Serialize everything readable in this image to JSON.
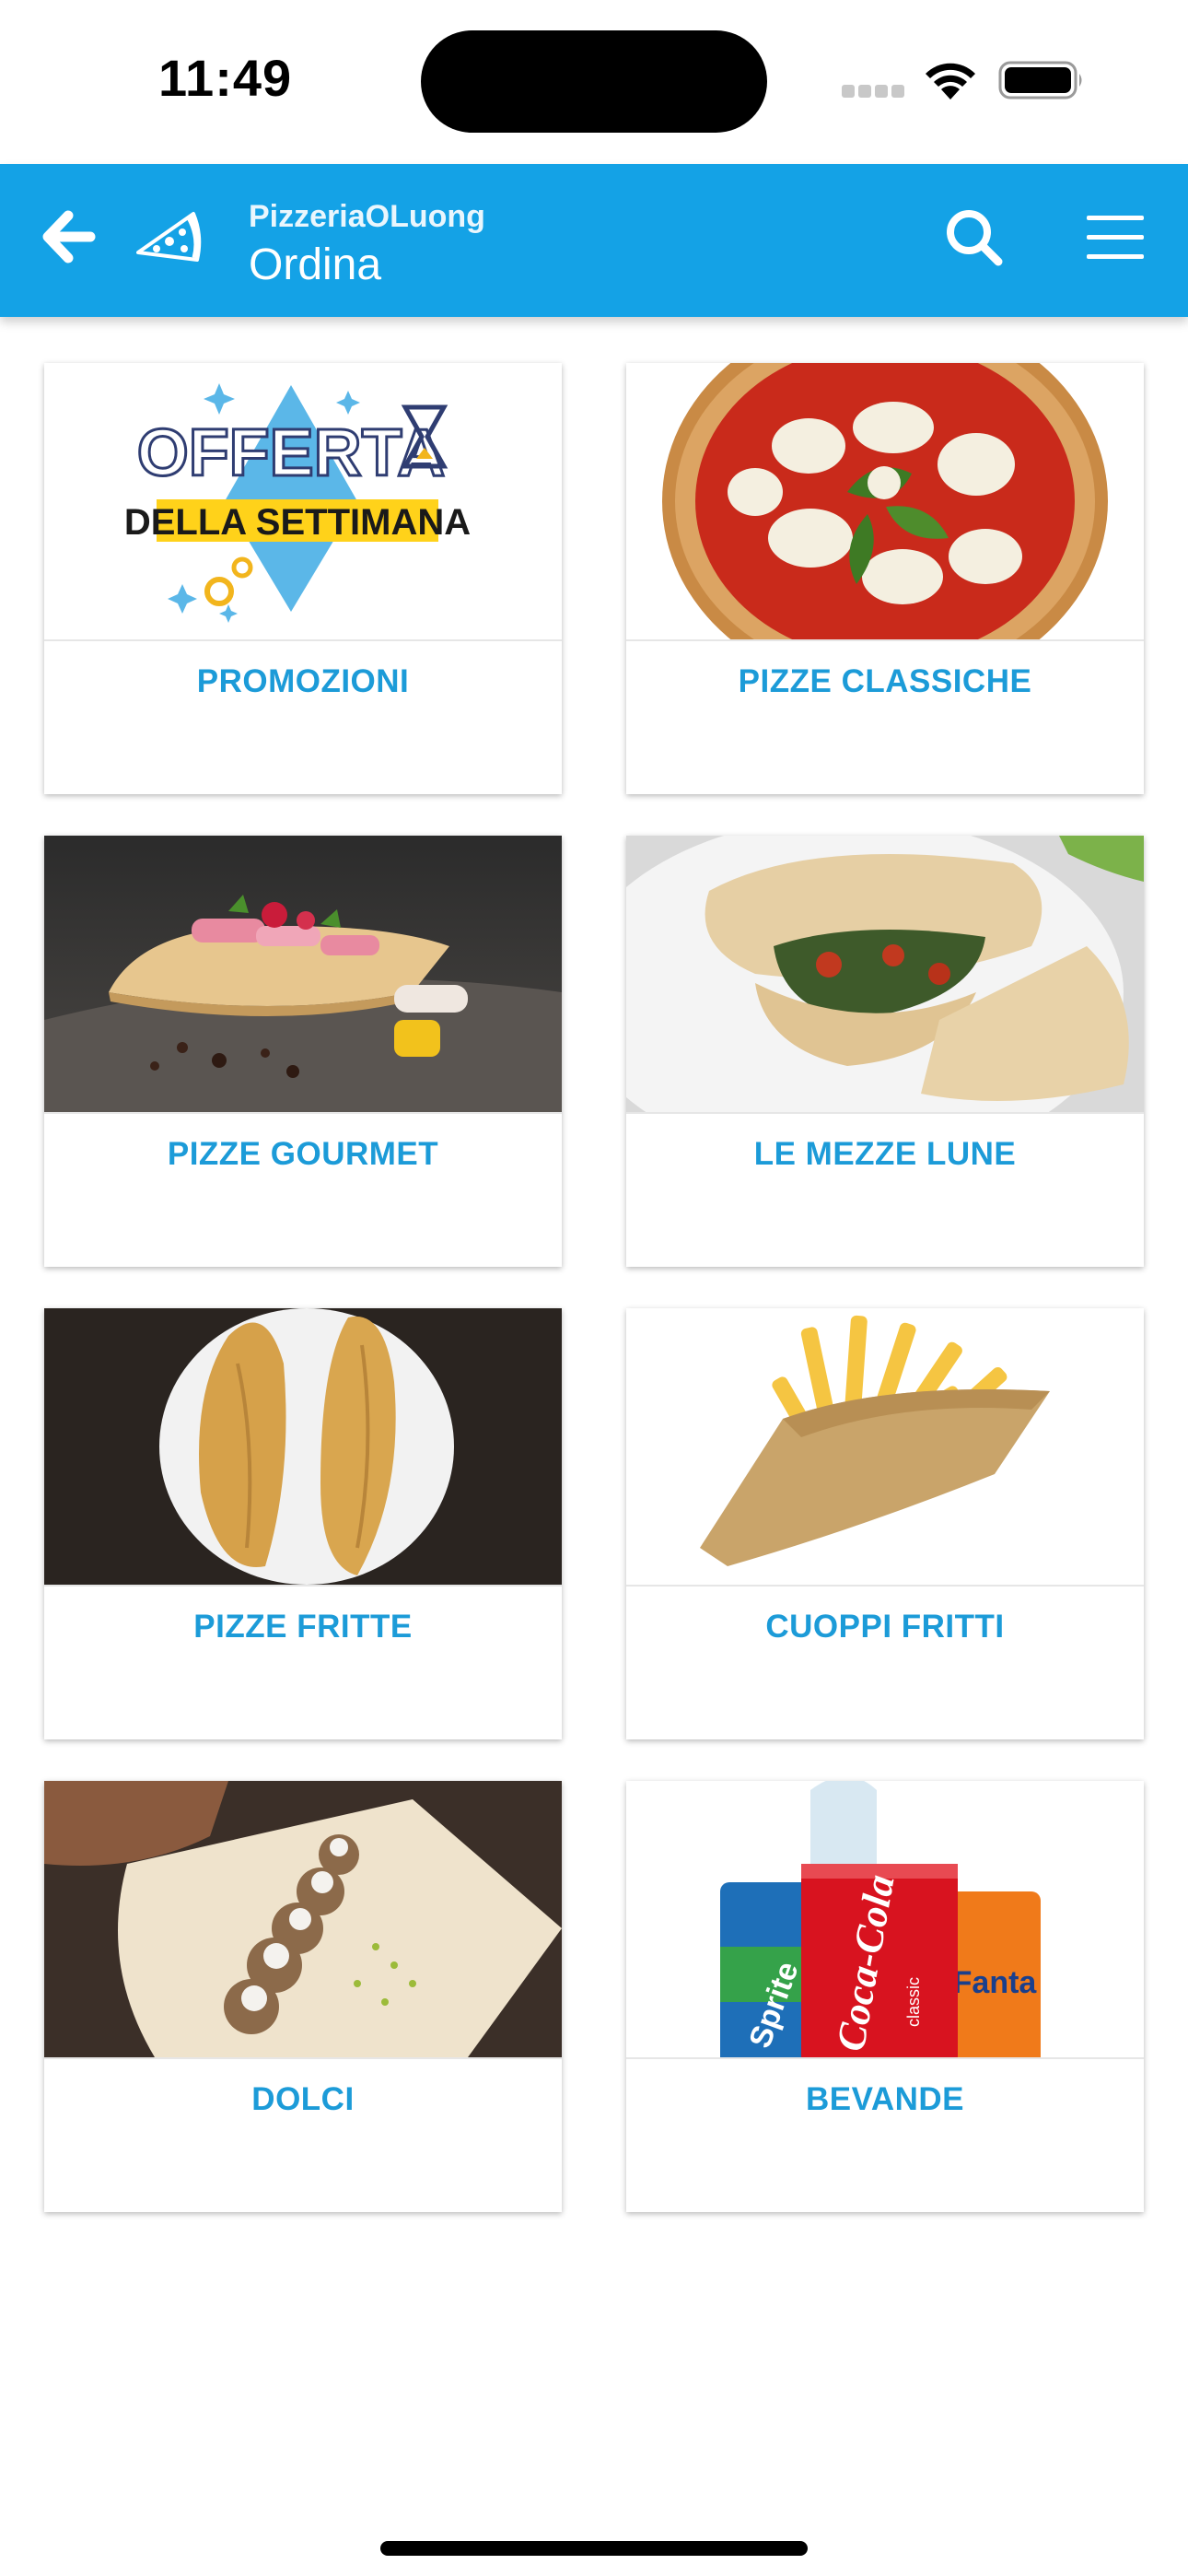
{
  "status_bar": {
    "time": "11:49"
  },
  "header": {
    "subtitle": "PizzeriaOLuong",
    "title": "Ordina"
  },
  "categories": [
    {
      "label": "PROMOZIONI",
      "image_text_1": "OFFERTA",
      "image_text_2": "DELLA SETTIMANA"
    },
    {
      "label": "PIZZE CLASSICHE"
    },
    {
      "label": "PIZZE GOURMET"
    },
    {
      "label": "LE MEZZE LUNE"
    },
    {
      "label": "PIZZE FRITTE"
    },
    {
      "label": "CUOPPI FRITTI"
    },
    {
      "label": "DOLCI"
    },
    {
      "label": "BEVANDE",
      "image_text_1": "Coca-Cola",
      "image_text_2": "classic",
      "image_text_3": "Sprite",
      "image_text_4": "Fanta"
    }
  ],
  "colors": {
    "header_bg": "#14a2e6",
    "label_color": "#1c9bd8"
  }
}
